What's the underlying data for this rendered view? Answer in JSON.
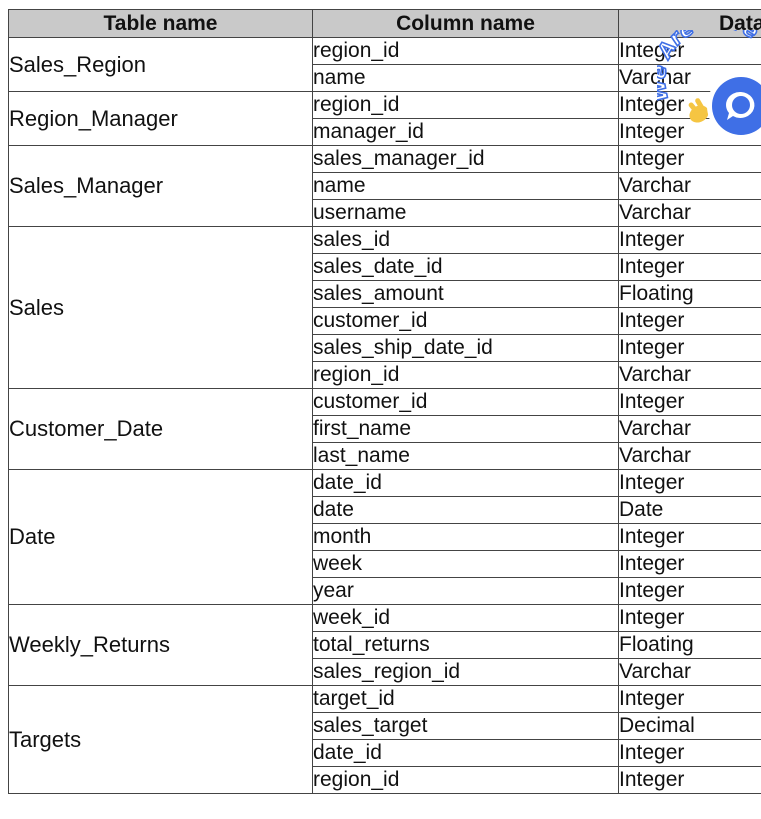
{
  "header": {
    "table_name": "Table name",
    "column_name": "Column name",
    "data_type": "Data"
  },
  "groups": [
    {
      "table": "Sales_Region",
      "rows": [
        {
          "column": "region_id",
          "type": "Integer"
        },
        {
          "column": "name",
          "type": "Varchar"
        }
      ]
    },
    {
      "table": "Region_Manager",
      "rows": [
        {
          "column": "region_id",
          "type": "Integer"
        },
        {
          "column": "manager_id",
          "type": "Integer"
        }
      ]
    },
    {
      "table": "Sales_Manager",
      "rows": [
        {
          "column": "sales_manager_id",
          "type": "Integer"
        },
        {
          "column": "name",
          "type": "Varchar"
        },
        {
          "column": "username",
          "type": "Varchar"
        }
      ]
    },
    {
      "table": "Sales",
      "rows": [
        {
          "column": "sales_id",
          "type": "Integer"
        },
        {
          "column": "sales_date_id",
          "type": "Integer"
        },
        {
          "column": "sales_amount",
          "type": "Floating"
        },
        {
          "column": "customer_id",
          "type": "Integer"
        },
        {
          "column": "sales_ship_date_id",
          "type": "Integer"
        },
        {
          "column": "region_id",
          "type": "Varchar"
        }
      ]
    },
    {
      "table": "Customer_Date",
      "rows": [
        {
          "column": "customer_id",
          "type": "Integer"
        },
        {
          "column": "first_name",
          "type": "Varchar"
        },
        {
          "column": "last_name",
          "type": "Varchar"
        }
      ]
    },
    {
      "table": "Date",
      "rows": [
        {
          "column": "date_id",
          "type": "Integer"
        },
        {
          "column": "date",
          "type": "Date"
        },
        {
          "column": "month",
          "type": "Integer"
        },
        {
          "column": "week",
          "type": "Integer"
        },
        {
          "column": "year",
          "type": "Integer"
        }
      ]
    },
    {
      "table": "Weekly_Returns",
      "rows": [
        {
          "column": "week_id",
          "type": "Integer"
        },
        {
          "column": "total_returns",
          "type": "Floating"
        },
        {
          "column": "sales_region_id",
          "type": "Varchar"
        }
      ]
    },
    {
      "table": "Targets",
      "rows": [
        {
          "column": "target_id",
          "type": "Integer"
        },
        {
          "column": "sales_target",
          "type": "Decimal"
        },
        {
          "column": "date_id",
          "type": "Integer"
        },
        {
          "column": "region_id",
          "type": "Integer"
        }
      ]
    }
  ],
  "chat_widget": {
    "text": "We Are Here",
    "icon": "chat-bubble-icon",
    "accent_color": "#3f6fe6"
  }
}
